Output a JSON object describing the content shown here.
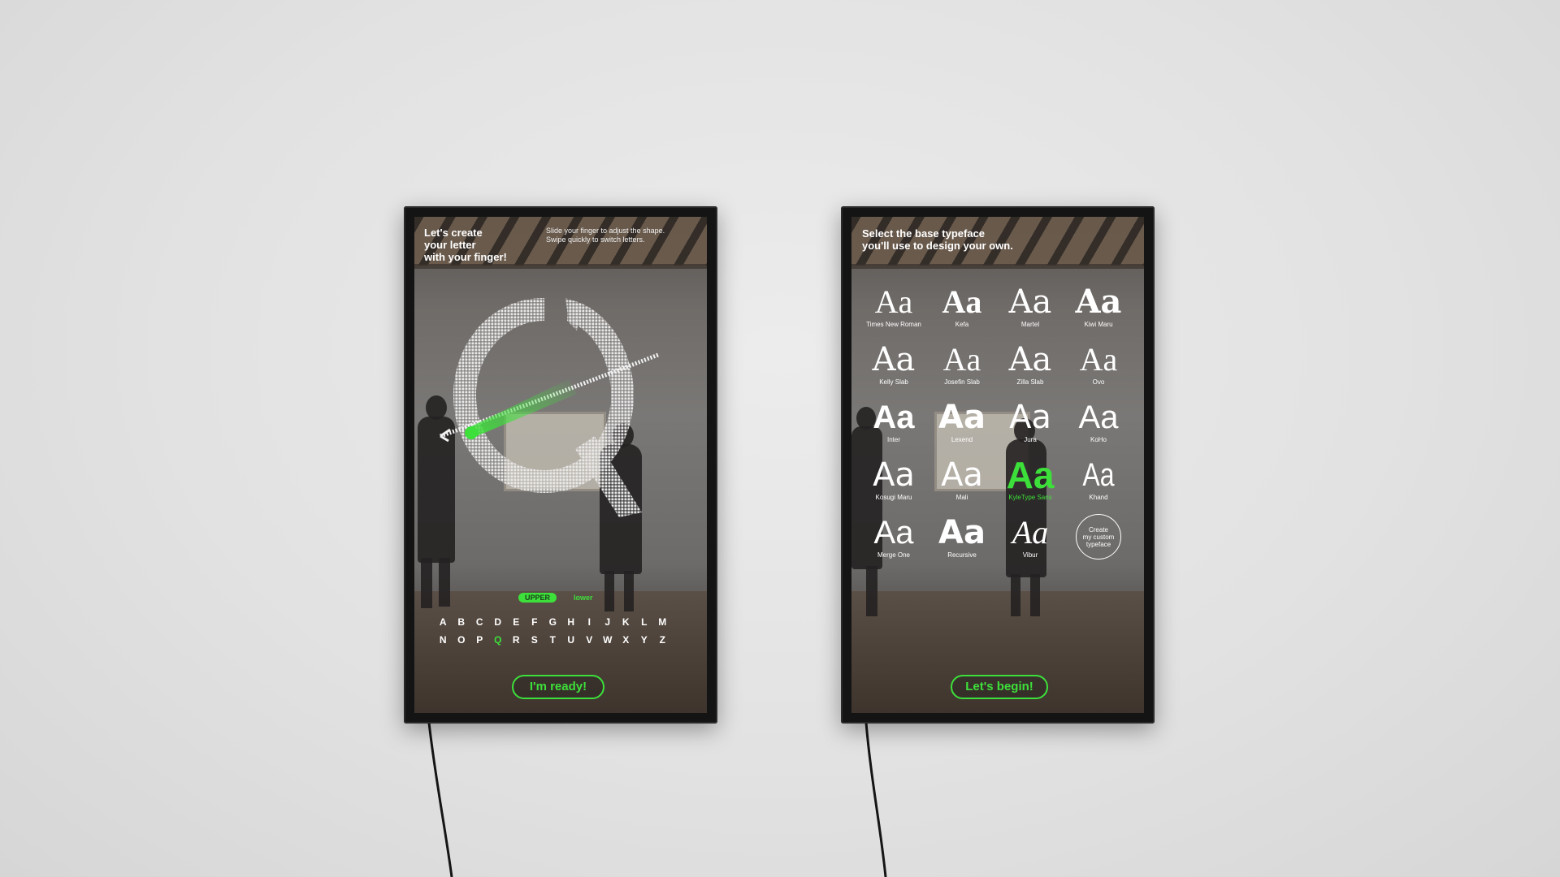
{
  "scene": {
    "accent_color": "#3de03a",
    "wall_color": "#e4e4e4"
  },
  "left_panel": {
    "title": "Let's create\nyour letter\nwith your finger!",
    "hint": "Slide your finger to adjust the shape.\nSwipe quickly to switch letters.",
    "current_letter": "Q",
    "case_toggle": {
      "upper": "UPPER",
      "lower": "lower",
      "selected": "upper"
    },
    "alphabet_row1": [
      "A",
      "B",
      "C",
      "D",
      "E",
      "F",
      "G",
      "H",
      "I",
      "J",
      "K",
      "L",
      "M"
    ],
    "alphabet_row2": [
      "N",
      "O",
      "P",
      "Q",
      "R",
      "S",
      "T",
      "U",
      "V",
      "W",
      "X",
      "Y",
      "Z"
    ],
    "selected_letter": "Q",
    "cta": "I'm ready!"
  },
  "right_panel": {
    "title": "Select the base typeface\nyou'll use to design your own.",
    "typefaces": [
      {
        "sample": "Aa",
        "name": "Times New Roman",
        "icon": "serif-sample"
      },
      {
        "sample": "Aa",
        "name": "Kefa",
        "icon": "serif-bold-sample"
      },
      {
        "sample": "Aa",
        "name": "Martel",
        "icon": "serif-sample"
      },
      {
        "sample": "Aa",
        "name": "Kiwi Maru",
        "icon": "serif-bold-sample"
      },
      {
        "sample": "Aa",
        "name": "Kelly Slab",
        "icon": "slab-sample"
      },
      {
        "sample": "Aa",
        "name": "Josefin Slab",
        "icon": "slab-light-sample"
      },
      {
        "sample": "Aa",
        "name": "Zilla Slab",
        "icon": "slab-sample"
      },
      {
        "sample": "Aa",
        "name": "Ovo",
        "icon": "serif-sample"
      },
      {
        "sample": "Aa",
        "name": "Inter",
        "icon": "sans-bold-sample"
      },
      {
        "sample": "Aa",
        "name": "Lexend",
        "icon": "sans-bold-sample"
      },
      {
        "sample": "Aa",
        "name": "Jura",
        "icon": "sans-light-sample"
      },
      {
        "sample": "Aa",
        "name": "KoHo",
        "icon": "sans-sample"
      },
      {
        "sample": "Aa",
        "name": "Kosugi Maru",
        "icon": "sans-sample"
      },
      {
        "sample": "Aa",
        "name": "Mali",
        "icon": "rounded-sample"
      },
      {
        "sample": "Aa",
        "name": "KyleType Sans",
        "icon": "sans-bold-sample",
        "selected": true
      },
      {
        "sample": "Aa",
        "name": "Khand",
        "icon": "condensed-sample"
      },
      {
        "sample": "Aa",
        "name": "Merge One",
        "icon": "sans-sample"
      },
      {
        "sample": "Aa",
        "name": "Recursive",
        "icon": "sans-bold-sample"
      },
      {
        "sample": "Aa",
        "name": "Vibur",
        "icon": "script-sample"
      }
    ],
    "custom_option": "Create\nmy custom\ntypeface",
    "cta": "Let's begin!"
  }
}
